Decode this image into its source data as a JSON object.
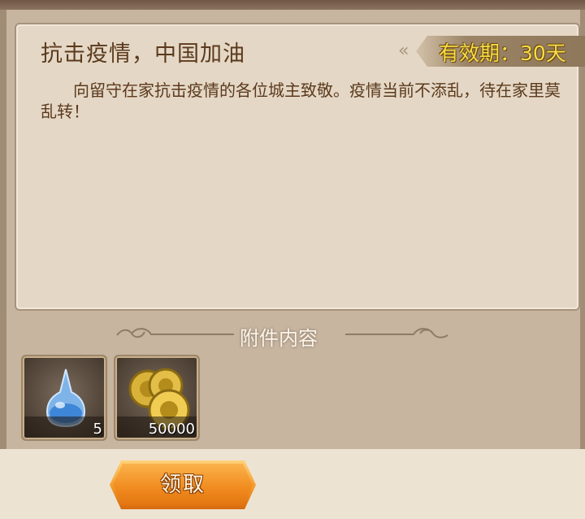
{
  "mail": {
    "title": "抗击疫情，中国加油",
    "expiry": "有效期：30天",
    "body": "向留守在家抗击疫情的各位城主致敬。疫情当前不添乱，待在家里莫乱转！"
  },
  "attachments": {
    "header": "附件内容",
    "items": [
      {
        "icon": "potion-icon",
        "count": "5"
      },
      {
        "icon": "gold-coins-icon",
        "count": "50000"
      }
    ]
  },
  "actions": {
    "claim_label": "领取"
  },
  "colors": {
    "title_text": "#5b3a1d",
    "expiry_text": "#f7dd47",
    "button_orange": "#f08a1e",
    "panel_bg": "#e4d7c5"
  }
}
